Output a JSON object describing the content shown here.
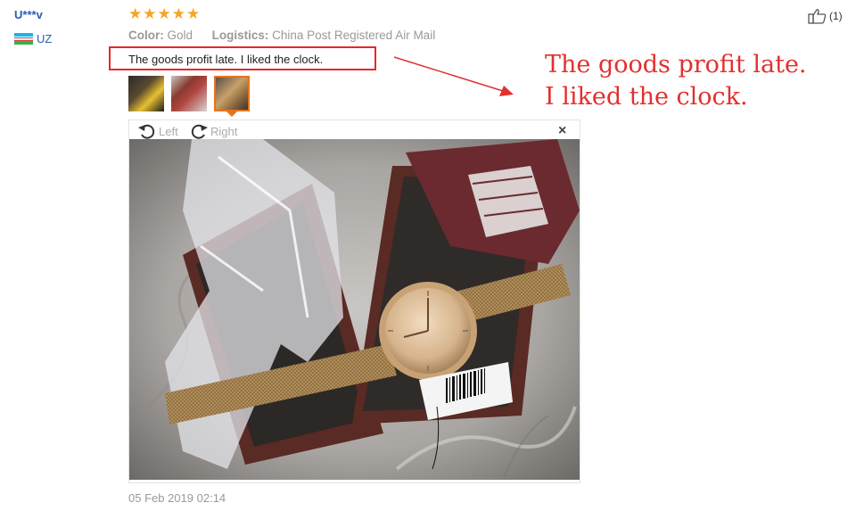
{
  "review": {
    "user": "U***v",
    "country": "UZ",
    "stars": "★★★★★",
    "rating": 5,
    "color_label": "Color:",
    "color_value": "Gold",
    "logistics_label": "Logistics:",
    "logistics_value": "China Post Registered Air Mail",
    "feedback": "The goods profit late. I liked the clock.",
    "date": "05 Feb 2019 02:14",
    "helpful_count": "(1)"
  },
  "viewer": {
    "rotate_left": "Left",
    "rotate_right": "Right",
    "close": "×",
    "selected_thumbnail": 3
  },
  "annotation": {
    "line1": "The goods profit late.",
    "line2": "I liked the clock."
  },
  "colors": {
    "stars": "#f5a623",
    "highlight_border": "#e8272a",
    "annotation_text": "#e23030",
    "selected_thumb": "#e8731c",
    "username": "#2a5db0"
  }
}
